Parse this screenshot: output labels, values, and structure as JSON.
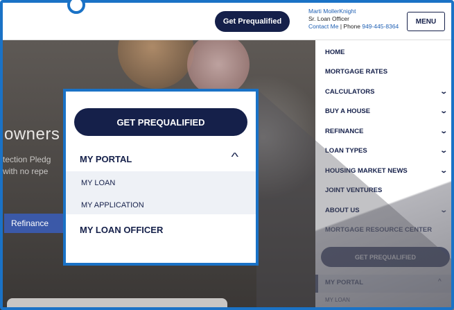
{
  "header": {
    "prequal_label": "Get Prequalified",
    "officer_name": "Marti MollerKnight",
    "officer_title": "Sr. Loan Officer",
    "contact_link": "Contact Me",
    "phone_prefix": " | Phone ",
    "phone_number": "949-445-8364",
    "menu_label": "MENU"
  },
  "hero": {
    "title_fragment": "owners",
    "subtitle_line1": "tection Pledg",
    "subtitle_line2": " with no repe",
    "refinance_label": "Refinance"
  },
  "side_menu": {
    "items": [
      {
        "label": "HOME",
        "chevron": ""
      },
      {
        "label": "MORTGAGE RATES",
        "chevron": ""
      },
      {
        "label": "CALCULATORS",
        "chevron": "⌄"
      },
      {
        "label": "BUY A HOUSE",
        "chevron": "⌄"
      },
      {
        "label": "REFINANCE",
        "chevron": "⌄"
      },
      {
        "label": "LOAN TYPES",
        "chevron": "⌄"
      },
      {
        "label": "HOUSING MARKET NEWS",
        "chevron": "⌄"
      },
      {
        "label": "JOINT VENTURES",
        "chevron": ""
      },
      {
        "label": "ABOUT US",
        "chevron": "⌄"
      },
      {
        "label": "MORTGAGE RESOURCE CENTER",
        "chevron": ""
      }
    ],
    "prequal_label": "GET PREQUALIFIED",
    "portal_label": "MY PORTAL",
    "portal_chevron": "^",
    "my_loan_label": "MY LOAN"
  },
  "popup": {
    "prequal_label": "GET PREQUALIFIED",
    "portal_label": "MY PORTAL",
    "portal_chevron": "^",
    "my_loan_label": "MY LOAN",
    "my_application_label": "MY APPLICATION",
    "loan_officer_label": "MY LOAN OFFICER"
  },
  "colors": {
    "navy": "#15204a",
    "frame_blue": "#1a72c6",
    "link_blue": "#1e5fb3",
    "refinance_blue": "#3b59a8"
  }
}
